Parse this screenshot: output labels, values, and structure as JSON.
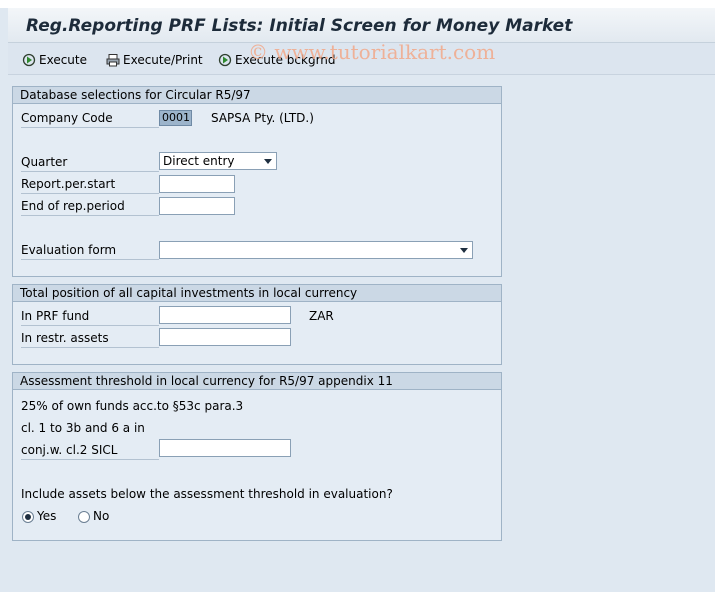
{
  "window": {
    "title": "Reg.Reporting PRF Lists: Initial Screen for Money Market"
  },
  "toolbar": {
    "execute": "Execute",
    "execute_print": "Execute/Print",
    "execute_background": "Execute bckgrnd"
  },
  "watermark": "© www.tutorialkart.com",
  "groups": {
    "database": {
      "title": "Database selections for Circular R5/97",
      "company_code_label": "Company Code",
      "company_code_value": "0001",
      "company_name": "SAPSA Pty. (LTD.)",
      "quarter_label": "Quarter",
      "quarter_value": "Direct entry",
      "report_start_label": "Report.per.start",
      "report_start_value": "",
      "report_end_label": "End of rep.period",
      "report_end_value": "",
      "evaluation_form_label": "Evaluation form",
      "evaluation_form_value": ""
    },
    "total_position": {
      "title": "Total position of all capital investments in local currency",
      "prf_fund_label": "In PRF fund",
      "prf_fund_value": "",
      "currency": "ZAR",
      "restr_assets_label": "In restr. assets",
      "restr_assets_value": ""
    },
    "threshold": {
      "title": "Assessment threshold in local currency for R5/97 appendix 11",
      "line1": "25% of own funds acc.to §53c para.3",
      "line2": "cl. 1 to 3b and 6 a in",
      "line3": "conj.w. cl.2 SICL",
      "threshold_value": "",
      "question": "Include assets below the assessment threshold in evaluation?",
      "yes_label": "Yes",
      "no_label": "No",
      "selected": "Yes"
    }
  }
}
